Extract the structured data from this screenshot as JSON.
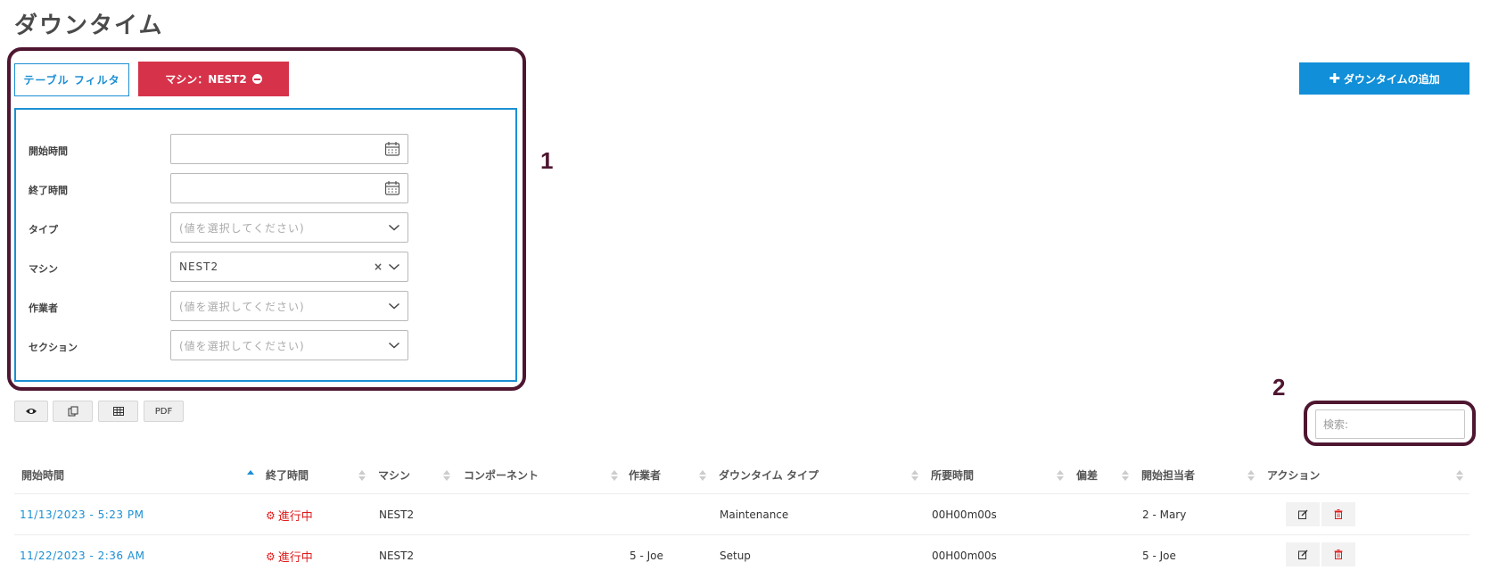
{
  "page": {
    "title": "ダウンタイム"
  },
  "callouts": {
    "one": "1",
    "two": "2"
  },
  "toolbar": {
    "table_filter_label": "テーブル フィルタ",
    "machine_chip_label": "マシン：NEST2",
    "add_downtime_label": "ダウンタイムの追加"
  },
  "filters": [
    {
      "label": "開始時間",
      "value": "",
      "placeholder": "",
      "icon": "calendar-icon"
    },
    {
      "label": "終了時間",
      "value": "",
      "placeholder": "",
      "icon": "calendar-icon"
    },
    {
      "label": "タイプ",
      "value": "",
      "placeholder": "(値を選択してください)",
      "icon": "chevron-down-icon"
    },
    {
      "label": "マシン",
      "value": "NEST2",
      "placeholder": "",
      "icon": "chevron-down-icon"
    },
    {
      "label": "作業者",
      "value": "",
      "placeholder": "(値を選択してください)",
      "icon": "chevron-down-icon"
    },
    {
      "label": "セクション",
      "value": "",
      "placeholder": "(値を選択してください)",
      "icon": "chevron-down-icon"
    }
  ],
  "export": {
    "pdf_label": "PDF"
  },
  "search": {
    "placeholder": "検索:"
  },
  "table": {
    "columns": [
      "開始時間",
      "終了時間",
      "マシン",
      "コンポーネント",
      "作業者",
      "ダウンタイム タイプ",
      "所要時間",
      "偏差",
      "開始担当者",
      "アクション"
    ],
    "rows": [
      {
        "start": "11/13/2023 - 5:23 PM",
        "end": "進行中",
        "machine": "NEST2",
        "component": "",
        "operator": "",
        "type": "Maintenance",
        "duration": "00H00m00s",
        "deviation": "",
        "started_by": "2 - Mary"
      },
      {
        "start": "11/22/2023 - 2:36 AM",
        "end": "進行中",
        "machine": "NEST2",
        "component": "",
        "operator": "5 - Joe",
        "type": "Setup",
        "duration": "00H00m00s",
        "deviation": "",
        "started_by": "5 - Joe"
      }
    ]
  },
  "colors": {
    "accent": "#1b8fd3",
    "chip_red": "#d6334b",
    "status_red": "#e11b1b",
    "callout": "#4e1630"
  }
}
